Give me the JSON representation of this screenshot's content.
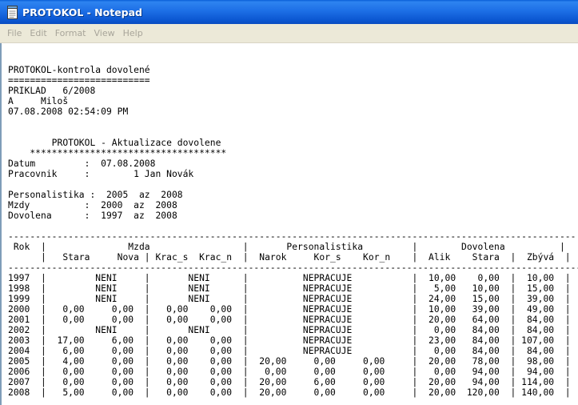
{
  "window": {
    "title": "PROTOKOL - Notepad",
    "icon": "notepad-icon"
  },
  "menu": {
    "items": [
      "File",
      "Edit",
      "Format",
      "View",
      "Help"
    ]
  },
  "document": {
    "lines": [
      "PROTOKOL-kontrola dovolené",
      "==========================",
      "PRIKLAD   6/2008",
      "A     Miloš",
      "07.08.2008 02:54:09 PM",
      "",
      "",
      "        PROTOKOL - Aktualizace dovolene",
      "    ************************************",
      "Datum         :  07.08.2008",
      "Pracovnik     :        1 Jan Novák",
      "",
      "Personalistika :  2005  az  2008",
      "Mzdy          :  2000  az  2008",
      "Dovolena      :  1997  az  2008",
      "",
      "--------------------------------------------------------------------------------------------------------",
      " Rok  |               Mzda                 |       Personalistika         |        Dovolena          |",
      "      |   Stara     Nova | Krac_s  Krac_n  |  Narok     Kor_s    Kor_n    |  Alik    Stara  |  Zbývá  |",
      "---------------------------------------------------------------------------------------------------------",
      "1997  |         NENI     |       NENI      |          NEPRACUJE           |  10,00    0,00  |  10,00  |",
      "1998  |         NENI     |       NENI      |          NEPRACUJE           |   5,00   10,00  |  15,00  |",
      "1999  |         NENI     |       NENI      |          NEPRACUJE           |  24,00   15,00  |  39,00  |",
      "2000  |   0,00     0,00  |   0,00    0,00  |          NEPRACUJE           |  10,00   39,00  |  49,00  |",
      "2001  |   0,00     0,00  |   0,00    0,00  |          NEPRACUJE           |  20,00   64,00  |  84,00  |",
      "2002  |         NENI     |       NENI      |          NEPRACUJE           |   0,00   84,00  |  84,00  |",
      "2003  |  17,00     6,00  |   0,00    0,00  |          NEPRACUJE           |  23,00   84,00  | 107,00  |",
      "2004  |   6,00     0,00  |   0,00    0,00  |          NEPRACUJE           |   0,00   84,00  |  84,00  |",
      "2005  |   4,00     0,00  |   0,00    0,00  |  20,00     0,00     0,00     |  20,00   78,00  |  98,00  |",
      "2006  |   0,00     0,00  |   0,00    0,00  |   0,00     0,00     0,00     |   0,00   94,00  |  94,00  |",
      "2007  |   0,00     0,00  |   0,00    0,00  |  20,00     6,00     0,00     |  20,00   94,00  | 114,00  |",
      "2008  |   5,00     0,00  |   0,00    0,00  |  20,00     0,00     0,00     |  20,00  120,00  | 140,00  |"
    ]
  }
}
